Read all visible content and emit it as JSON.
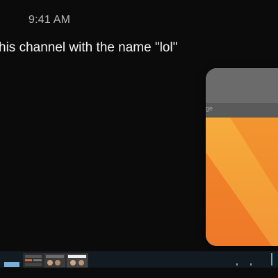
{
  "status_bar": {
    "time": "9:41 AM"
  },
  "message": {
    "text": "his channel with the name \"lol\""
  },
  "preview": {
    "bar_text": "ge",
    "colors": {
      "orange_light": "#f3a334",
      "orange_mid": "#f08a2c",
      "orange_dark": "#ec7228",
      "header_gray": "#6b6b6b"
    }
  },
  "dock": {
    "accent_color": "#7ab0d8",
    "thumbnails": [
      "thumbnail-1",
      "thumbnail-2",
      "thumbnail-3"
    ]
  }
}
